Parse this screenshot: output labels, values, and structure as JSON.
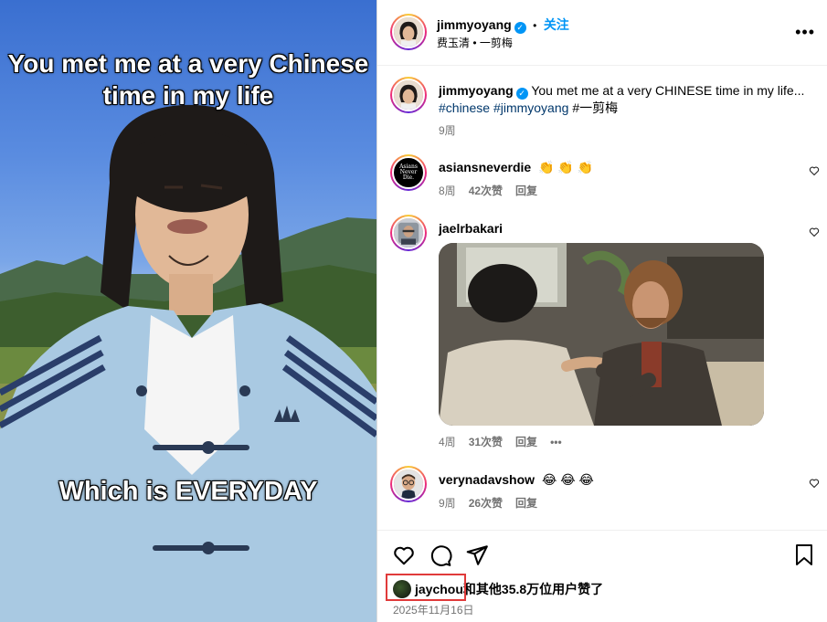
{
  "media": {
    "caption_top": "You met me at a very Chinese time in my life",
    "caption_bottom": "Which is EVERYDAY"
  },
  "post": {
    "username": "jimmyoyang",
    "follow_label": "关注",
    "dot": "•",
    "subtitle": "费玉清 • 一剪梅",
    "more": "•••"
  },
  "caption": {
    "username": "jimmyoyang",
    "text": "You met me at a very CHINESE time in my life...",
    "hashtags": [
      "#chinese",
      "#jimmyoyang"
    ],
    "tag_tail": "#一剪梅",
    "age": "9周"
  },
  "comments": [
    {
      "username": "asiansneverdie",
      "text": "👏 👏 👏",
      "age": "8周",
      "likes": "42次赞",
      "reply": "回复",
      "avatar_text": "Asians Never Die."
    },
    {
      "username": "jaelrbakari",
      "text": "",
      "age": "4周",
      "likes": "31次赞",
      "reply": "回复",
      "extra": "•••"
    },
    {
      "username": "verynadavshow",
      "text": "😂 😂 😂",
      "age": "9周",
      "likes": "26次赞",
      "reply": "回复"
    }
  ],
  "likes": {
    "user": "jaychou",
    "rest": "和其他35.8万位用户赞了",
    "date": "2025年11月16日"
  },
  "colors": {
    "accent": "#0095f6",
    "link": "#00376b",
    "muted": "#737373",
    "highlight": "#e03a3a"
  }
}
